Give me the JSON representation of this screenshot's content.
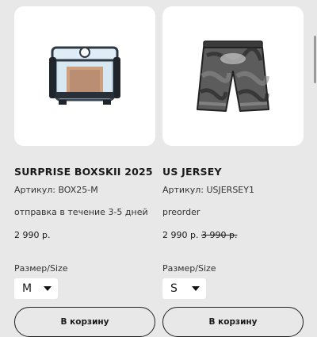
{
  "products": [
    {
      "title": "SURPRISE BOXSKII 2025",
      "sku": "Артикул: BOX25-M",
      "shipping": "отправка в течение 3-5 дней",
      "price": "2 990 р.",
      "old_price": "",
      "size_label": "Размер/Size",
      "size_value": "M",
      "button_label": "В корзину",
      "image": "mystery-box-image"
    },
    {
      "title": "US JERSEY",
      "sku": "Артикул: USJERSEY1",
      "shipping": "preorder",
      "price": "2 990 р.",
      "old_price": "3 990 р.",
      "size_label": "Размер/Size",
      "size_value": "S",
      "button_label": "В корзину",
      "image": "jersey-shorts-image"
    }
  ],
  "colors": {
    "background": "#e8e8e8",
    "card": "#ffffff",
    "text": "#1a1a1a"
  }
}
